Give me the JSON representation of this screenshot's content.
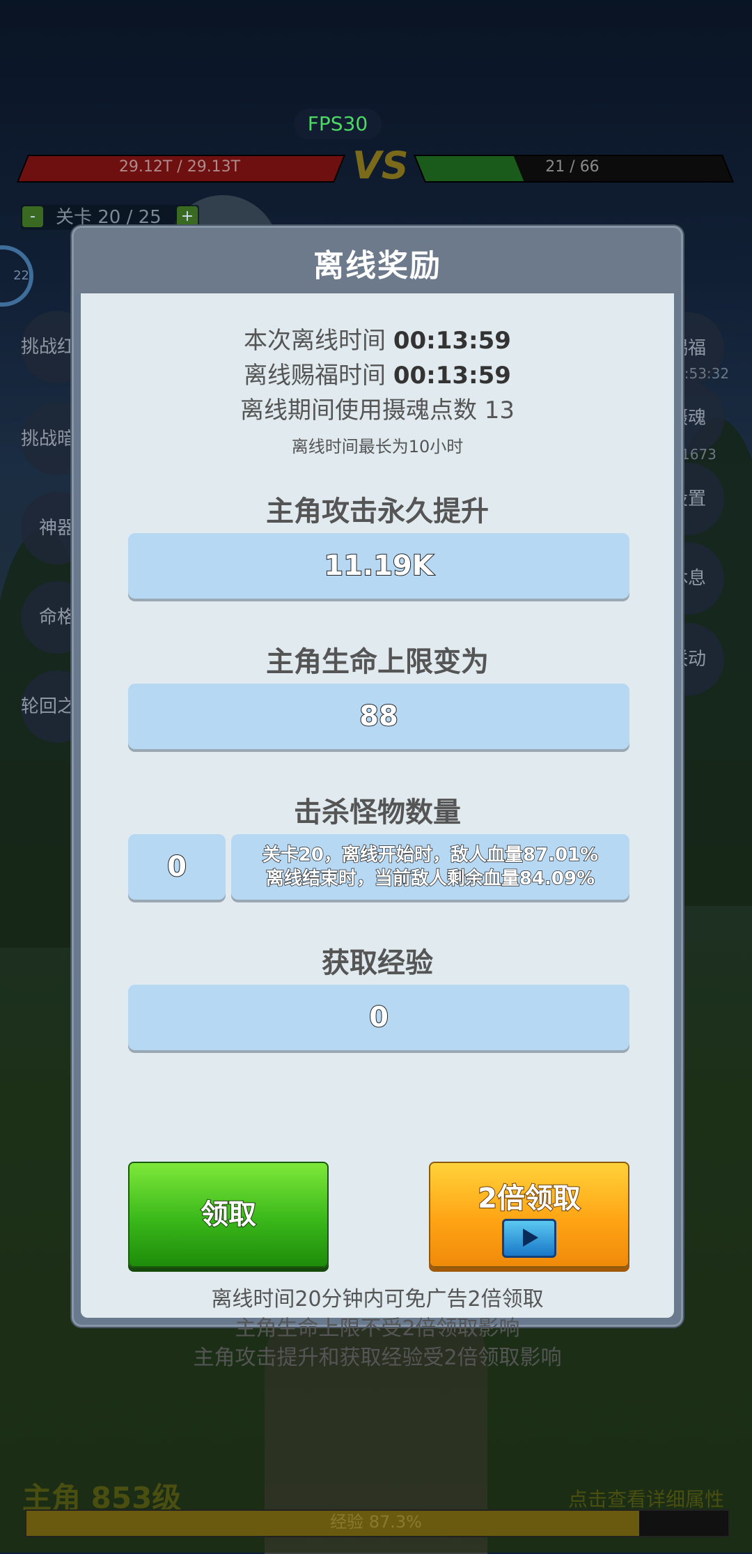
{
  "hud": {
    "fps": "FPS30",
    "player_hp": "29.12T / 29.13T",
    "vs": "VS",
    "enemy_hp": "21 / 66",
    "enemy_hp_fraction": 0.32,
    "stage_minus": "-",
    "stage_label": "关卡 20 / 25",
    "stage_plus": "+",
    "ring_value": "22"
  },
  "side_left": [
    {
      "label": "挑战红龙"
    },
    {
      "label": "挑战暗龙"
    },
    {
      "label": "神器"
    },
    {
      "label": "命格"
    },
    {
      "label": "轮回之塔"
    }
  ],
  "side_right": [
    {
      "label": "赐福",
      "sub": "5:53:32"
    },
    {
      "label": "摄魂",
      "sub": "1673"
    },
    {
      "label": "设置"
    },
    {
      "label": "休息"
    },
    {
      "label": "联动"
    }
  ],
  "dialog": {
    "title": "离线奖励",
    "offline_time_label": "本次离线时间",
    "offline_time_value": "00:13:59",
    "bless_time_label": "离线赐福时间",
    "bless_time_value": "00:13:59",
    "soul_points_text": "离线期间使用摄魂点数 13",
    "max_note": "离线时间最长为10小时",
    "attack_title": "主角攻击永久提升",
    "attack_value": "11.19K",
    "hp_title": "主角生命上限变为",
    "hp_value": "88",
    "kill_title": "击杀怪物数量",
    "kill_value": "0",
    "kill_desc_line1": "关卡20，离线开始时，敌人血量87.01%",
    "kill_desc_line2": "离线结束时，当前敌人剩余血量84.09%",
    "exp_title": "获取经验",
    "exp_value": "0",
    "claim_button": "领取",
    "double_button": "2倍领取",
    "footer_line1": "离线时间20分钟内可免广告2倍领取",
    "footer_line2": "主角生命上限不受2倍领取影响",
    "footer_line3": "主角攻击提升和获取经验受2倍领取影响"
  },
  "bottom": {
    "hero_level": "主角 853级",
    "detail_link": "点击查看详细属性",
    "exp_text": "经验 87.3%",
    "exp_fraction": 0.873
  }
}
